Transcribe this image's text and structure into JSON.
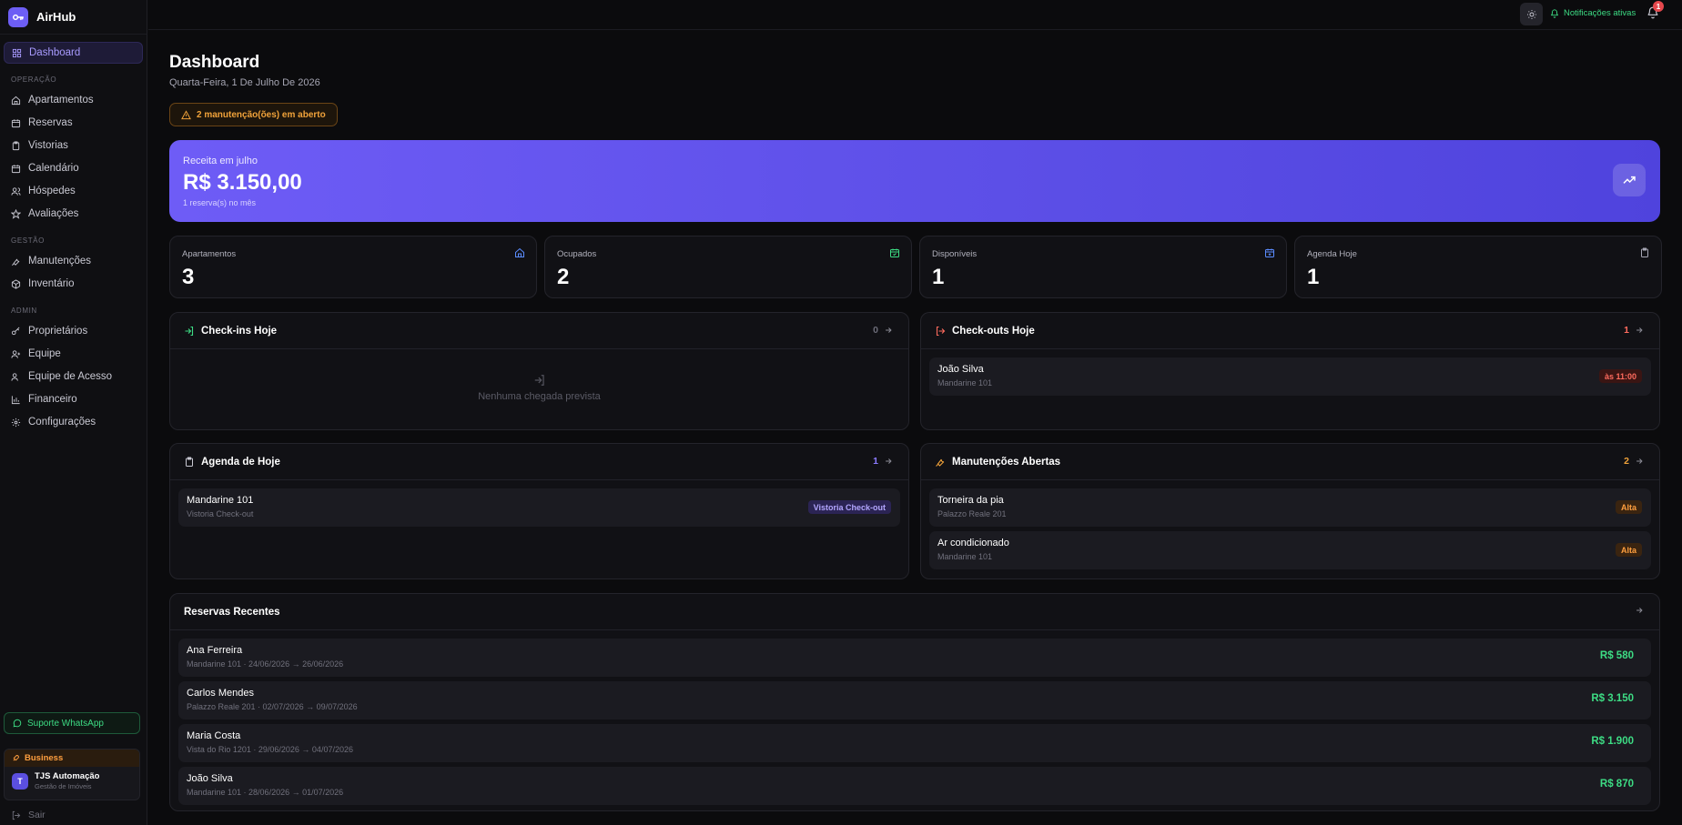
{
  "brand": {
    "name": "AirHub"
  },
  "sidebar": {
    "items": [
      {
        "label": "Dashboard",
        "icon": "grid-icon",
        "active": true
      },
      {
        "section": "OPERAÇÃO"
      },
      {
        "label": "Apartamentos",
        "icon": "home-icon"
      },
      {
        "label": "Reservas",
        "icon": "calendar-icon"
      },
      {
        "label": "Vistorias",
        "icon": "clipboard-icon"
      },
      {
        "label": "Calendário",
        "icon": "calendar-icon"
      },
      {
        "label": "Hóspedes",
        "icon": "users-icon"
      },
      {
        "label": "Avaliações",
        "icon": "star-icon"
      },
      {
        "section": "GESTÃO"
      },
      {
        "label": "Manutenções",
        "icon": "wrench-icon"
      },
      {
        "label": "Inventário",
        "icon": "box-icon"
      },
      {
        "section": "ADMIN"
      },
      {
        "label": "Proprietários",
        "icon": "key-icon"
      },
      {
        "label": "Equipe",
        "icon": "user-plus-icon"
      },
      {
        "label": "Equipe de Acesso",
        "icon": "users-icon"
      },
      {
        "label": "Financeiro",
        "icon": "bar-chart-icon"
      },
      {
        "label": "Configurações",
        "icon": "gear-icon"
      }
    ],
    "support_label": "Suporte WhatsApp",
    "plan": {
      "label": "Business",
      "avatar": "T",
      "company": "TJS Automação",
      "subtitle": "Gestão de Imóveis"
    },
    "logout_label": "Sair"
  },
  "topbar": {
    "notifications_label": "Notificações ativas",
    "bell_count": "1"
  },
  "header": {
    "title": "Dashboard",
    "date": "Quarta-Feira, 1 De Julho De 2026",
    "alert": "2 manutenção(ões) em aberto"
  },
  "revenue": {
    "label": "Receita em julho",
    "value": "R$ 3.150,00",
    "sub": "1 reserva(s) no mês"
  },
  "stats": [
    {
      "label": "Apartamentos",
      "value": "3",
      "icon": "home-icon",
      "color": "#5b8cff"
    },
    {
      "label": "Ocupados",
      "value": "2",
      "icon": "calendar-check-icon",
      "color": "#3ddc84"
    },
    {
      "label": "Disponíveis",
      "value": "1",
      "icon": "calendar-plus-icon",
      "color": "#5b8cff"
    },
    {
      "label": "Agenda Hoje",
      "value": "1",
      "icon": "clipboard-icon",
      "color": "#a6a6b3"
    }
  ],
  "checkins": {
    "title": "Check-ins Hoje",
    "count": "0",
    "empty": "Nenhuma chegada prevista"
  },
  "checkouts": {
    "title": "Check-outs Hoje",
    "count": "1",
    "rows": [
      {
        "title": "João Silva",
        "sub": "Mandarine 101",
        "badge": "às 11:00"
      }
    ]
  },
  "agenda": {
    "title": "Agenda de Hoje",
    "count": "1",
    "rows": [
      {
        "title": "Mandarine 101",
        "sub": "Vistoria Check-out",
        "badge": "Vistoria Check-out"
      }
    ]
  },
  "maintenance": {
    "title": "Manutenções Abertas",
    "count": "2",
    "rows": [
      {
        "title": "Torneira da pia",
        "sub": "Palazzo Reale 201",
        "badge": "Alta"
      },
      {
        "title": "Ar condicionado",
        "sub": "Mandarine 101",
        "badge": "Alta"
      }
    ]
  },
  "recent": {
    "title": "Reservas Recentes",
    "rows": [
      {
        "name": "Ana Ferreira",
        "sub": "Mandarine 101 · 24/06/2026 → 26/06/2026",
        "amount": "R$ 580"
      },
      {
        "name": "Carlos Mendes",
        "sub": "Palazzo Reale 201 · 02/07/2026 → 09/07/2026",
        "amount": "R$ 3.150"
      },
      {
        "name": "Maria Costa",
        "sub": "Vista do Rio 1201 · 29/06/2026 → 04/07/2026",
        "amount": "R$ 1.900"
      },
      {
        "name": "João Silva",
        "sub": "Mandarine 101 · 28/06/2026 → 01/07/2026",
        "amount": "R$ 870"
      }
    ]
  }
}
